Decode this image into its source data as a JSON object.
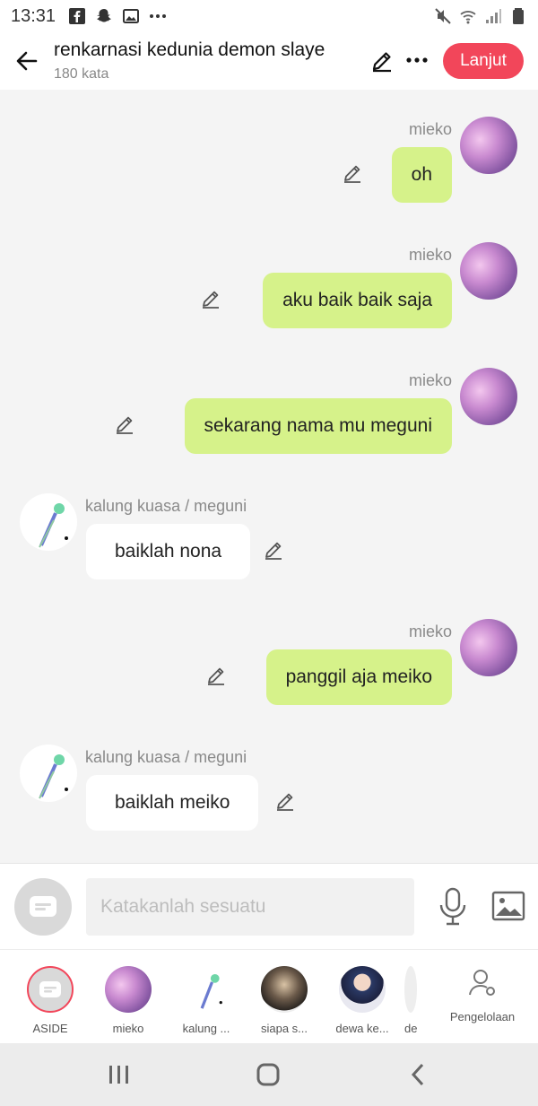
{
  "status": {
    "time": "13:31",
    "left_icons": [
      "facebook-icon",
      "snapchat-icon",
      "gallery-icon",
      "more-dots-icon"
    ],
    "right_icons": [
      "mute-icon",
      "wifi-icon",
      "signal-icon",
      "battery-icon"
    ]
  },
  "header": {
    "title": "renkarnasi kedunia demon slaye",
    "subtitle": "180 kata",
    "next_label": "Lanjut",
    "accent": "#f2465a"
  },
  "messages": [
    {
      "side": "out",
      "sender": "mieko",
      "text": "oh"
    },
    {
      "side": "out",
      "sender": "mieko",
      "text": "aku baik baik saja"
    },
    {
      "side": "out",
      "sender": "mieko",
      "text": "sekarang nama mu meguni"
    },
    {
      "side": "in",
      "sender": "kalung kuasa / meguni",
      "text": "baiklah nona"
    },
    {
      "side": "out",
      "sender": "mieko",
      "text": "panggil aja meiko"
    },
    {
      "side": "in",
      "sender": "kalung kuasa / meguni",
      "text": "baiklah meiko"
    }
  ],
  "bubble_colors": {
    "out": "#d6f28a",
    "in": "#ffffff"
  },
  "composer": {
    "placeholder": "Katakanlah sesuatu"
  },
  "characters": [
    {
      "label": "ASIDE"
    },
    {
      "label": "mieko"
    },
    {
      "label": "kalung ..."
    },
    {
      "label": "siapa s..."
    },
    {
      "label": "dewa ke..."
    },
    {
      "label": "de"
    }
  ],
  "management_label": "Pengelolaan"
}
